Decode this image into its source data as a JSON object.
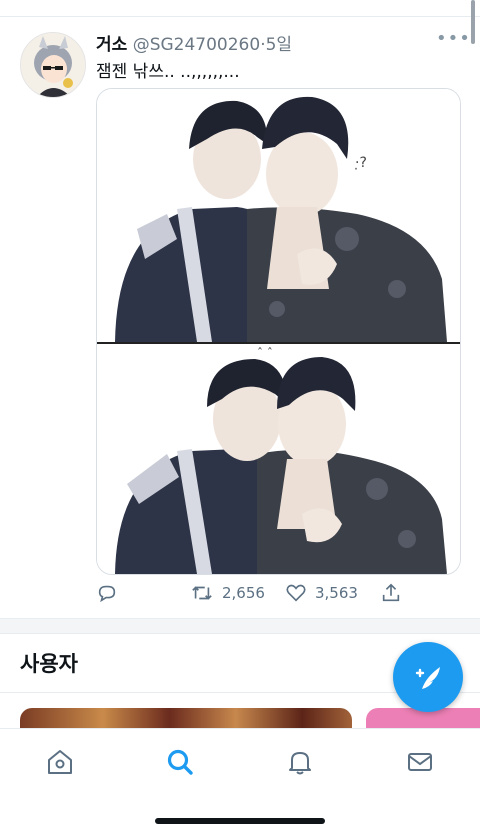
{
  "tweet": {
    "display_name": "거소",
    "handle": "@SG24700260",
    "time": "5일",
    "separator": "·",
    "text": "잼젠 낚쓰.. ..,,,,,,...",
    "more_icon": "more-horizontal-icon",
    "avatar_icon": "profile-avatar",
    "media_description": "two-panel illustration image",
    "actions": {
      "reply_icon": "reply-icon",
      "retweet_icon": "retweet-icon",
      "retweet_count": "2,656",
      "like_icon": "heart-icon",
      "like_count": "3,563",
      "share_icon": "share-icon"
    }
  },
  "section": {
    "title": "사용자"
  },
  "fab": {
    "icon": "compose-feather-icon"
  },
  "tabbar": {
    "items": [
      {
        "icon": "home-icon",
        "active": false
      },
      {
        "icon": "search-icon",
        "active": true
      },
      {
        "icon": "bell-icon",
        "active": false
      },
      {
        "icon": "mail-icon",
        "active": false
      }
    ]
  },
  "colors": {
    "accent": "#1d9bf0",
    "text": "#0f1419",
    "muted": "#6b7884",
    "divider": "#e6ecf0"
  }
}
